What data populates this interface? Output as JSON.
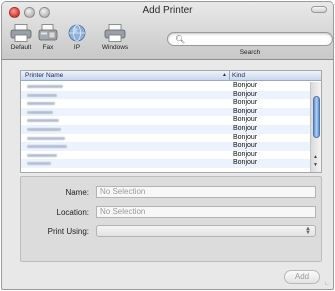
{
  "window": {
    "title": "Add Printer"
  },
  "toolbar": {
    "items": [
      {
        "label": "Default",
        "icon": "printer-icon"
      },
      {
        "label": "Fax",
        "icon": "fax-icon"
      },
      {
        "label": "IP",
        "icon": "globe-icon"
      },
      {
        "label": "Windows",
        "icon": "windows-printer-icon"
      }
    ],
    "search": {
      "label": "Search",
      "value": ""
    }
  },
  "printer_list": {
    "columns": {
      "name": "Printer Name",
      "kind": "Kind"
    },
    "sorted_by": "Printer Name",
    "rows": [
      {
        "kind": "Bonjour"
      },
      {
        "kind": "Bonjour"
      },
      {
        "kind": "Bonjour"
      },
      {
        "kind": "Bonjour"
      },
      {
        "kind": "Bonjour"
      },
      {
        "kind": "Bonjour"
      },
      {
        "kind": "Bonjour"
      },
      {
        "kind": "Bonjour"
      },
      {
        "kind": "Bonjour"
      },
      {
        "kind": "Bonjour"
      }
    ]
  },
  "details": {
    "name_label": "Name:",
    "name_value": "No Selection",
    "location_label": "Location:",
    "location_value": "No Selection",
    "print_using_label": "Print Using:",
    "print_using_value": ""
  },
  "actions": {
    "add_label": "Add"
  }
}
